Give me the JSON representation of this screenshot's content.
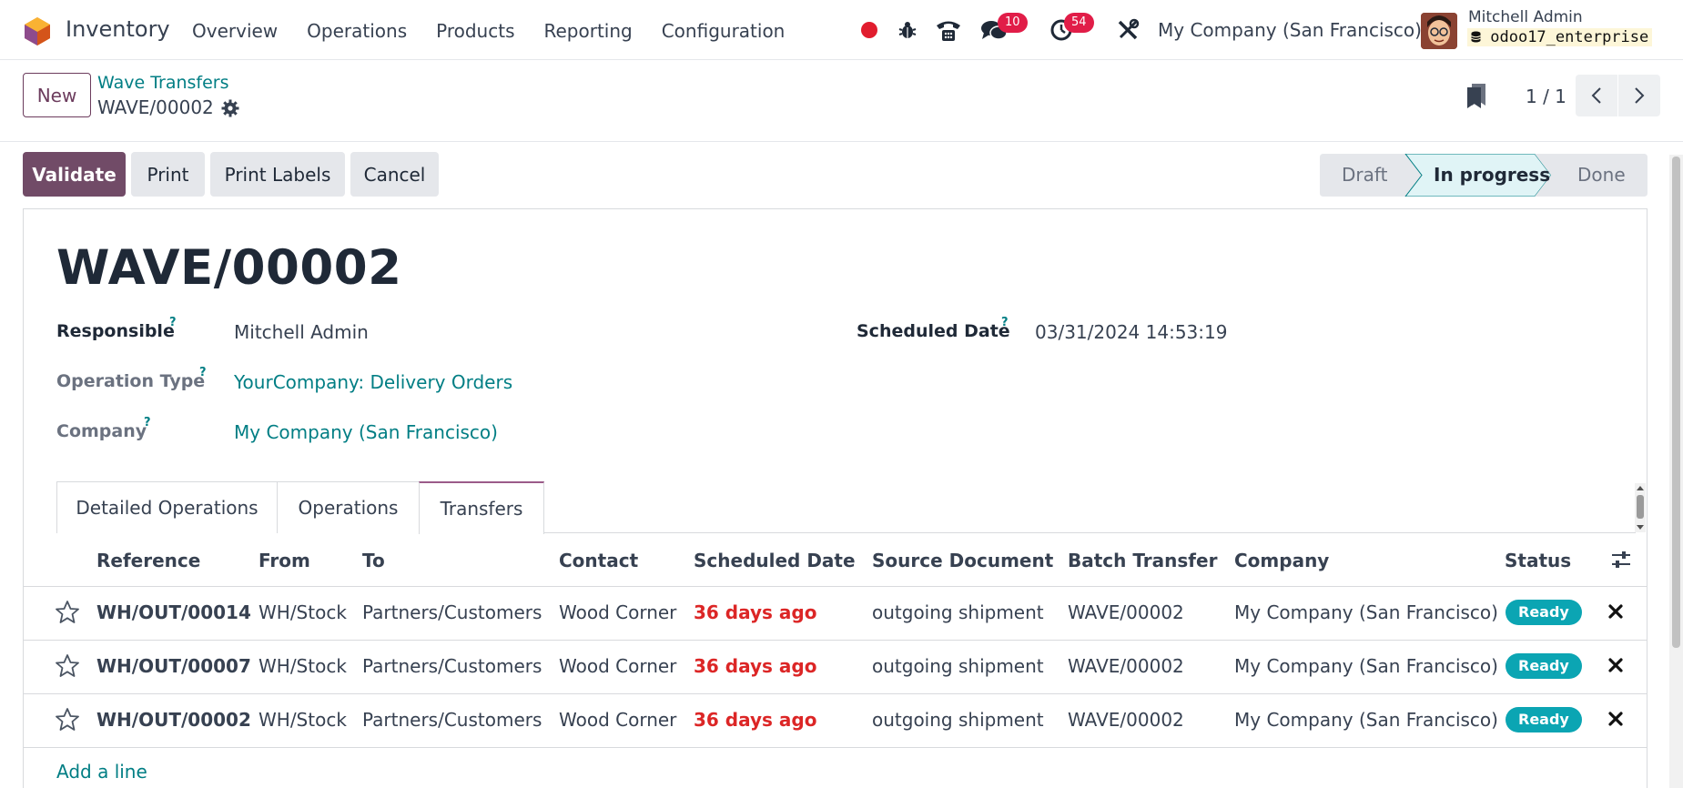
{
  "navbar": {
    "app_name": "Inventory",
    "menu": [
      "Overview",
      "Operations",
      "Products",
      "Reporting",
      "Configuration"
    ],
    "messages_count": "10",
    "activities_count": "54",
    "company": "My Company (San Francisco)",
    "user_name": "Mitchell Admin",
    "database": "odoo17_enterprise"
  },
  "control_panel": {
    "new_label": "New",
    "breadcrumb_parent": "Wave Transfers",
    "breadcrumb_current": "WAVE/00002",
    "pager": "1 / 1"
  },
  "actions": {
    "validate": "Validate",
    "print": "Print",
    "print_labels": "Print Labels",
    "cancel": "Cancel"
  },
  "status_steps": [
    "Draft",
    "In progress",
    "Done"
  ],
  "form": {
    "title": "WAVE/00002",
    "responsible_label": "Responsible",
    "responsible_value": "Mitchell Admin",
    "operation_type_label": "Operation Type",
    "operation_type_value": "YourCompany: Delivery Orders",
    "company_label": "Company",
    "company_value": "My Company (San Francisco)",
    "scheduled_date_label": "Scheduled Date",
    "scheduled_date_value": "03/31/2024 14:53:19",
    "help_mark": "?"
  },
  "tabs": [
    "Detailed Operations",
    "Operations",
    "Transfers"
  ],
  "table": {
    "columns": [
      "Reference",
      "From",
      "To",
      "Contact",
      "Scheduled Date",
      "Source Document",
      "Batch Transfer",
      "Company",
      "Status"
    ],
    "rows": [
      {
        "reference": "WH/OUT/00014",
        "from": "WH/Stock",
        "to": "Partners/Customers",
        "contact": "Wood Corner",
        "scheduled": "36 days ago",
        "source": "outgoing shipment",
        "batch": "WAVE/00002",
        "company": "My Company (San Francisco)",
        "status": "Ready"
      },
      {
        "reference": "WH/OUT/00007",
        "from": "WH/Stock",
        "to": "Partners/Customers",
        "contact": "Wood Corner",
        "scheduled": "36 days ago",
        "source": "outgoing shipment",
        "batch": "WAVE/00002",
        "company": "My Company (San Francisco)",
        "status": "Ready"
      },
      {
        "reference": "WH/OUT/00002",
        "from": "WH/Stock",
        "to": "Partners/Customers",
        "contact": "Wood Corner",
        "scheduled": "36 days ago",
        "source": "outgoing shipment",
        "batch": "WAVE/00002",
        "company": "My Company (San Francisco)",
        "status": "Ready"
      }
    ],
    "add_line": "Add a line"
  },
  "colors": {
    "brand": "#714b67",
    "link": "#017e84",
    "danger": "#dc2626",
    "ready": "#0ba5b3",
    "badge": "#e11d48"
  }
}
